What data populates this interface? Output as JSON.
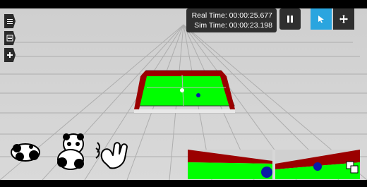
{
  "app": {
    "hud": {
      "real_time": "Real Time: 00:00:25.677",
      "sim_time": "Sim Time: 00:00:23.198"
    },
    "toolbar": {
      "pause_icon": "pause-icon",
      "select_icon": "select-cursor-icon",
      "move_icon": "move-arrows-icon"
    },
    "left_tabs": [
      {
        "icon": "menu-icon"
      },
      {
        "icon": "panel-icon"
      },
      {
        "icon": "add-icon"
      }
    ],
    "emojis": [
      {
        "icon": "panda-lying-icon"
      },
      {
        "icon": "panda-sitting-icon"
      },
      {
        "icon": "waving-hand-icon"
      }
    ],
    "colors": {
      "floor": "#d9d9d9",
      "grid": "#a7a7a7",
      "field": "#00ff00",
      "wall": "#9b0000",
      "ball": "#0a1aa8"
    }
  }
}
